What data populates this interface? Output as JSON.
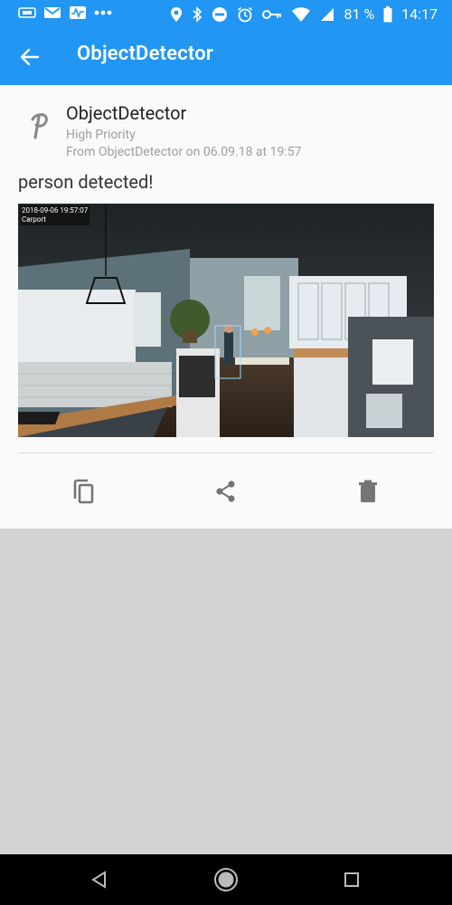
{
  "status": {
    "battery": "81 %",
    "time": "14:17"
  },
  "appbar": {
    "title": "ObjectDetector"
  },
  "notification": {
    "app_name": "ObjectDetector",
    "priority": "High Priority",
    "from_line": "From ObjectDetector on 06.09.18 at 19:57",
    "message": "person detected!",
    "image": {
      "timestamp": "2018-09-06 19:57:07",
      "camera": "Carport"
    }
  },
  "actions": [
    "copy-icon",
    "share-icon",
    "delete-icon"
  ],
  "colors": {
    "primary": "#2196f3",
    "card_bg": "#fafafa",
    "empty_bg": "#d4d4d4",
    "nav_bg": "#000000",
    "secondary_text": "#9e9e9e"
  }
}
